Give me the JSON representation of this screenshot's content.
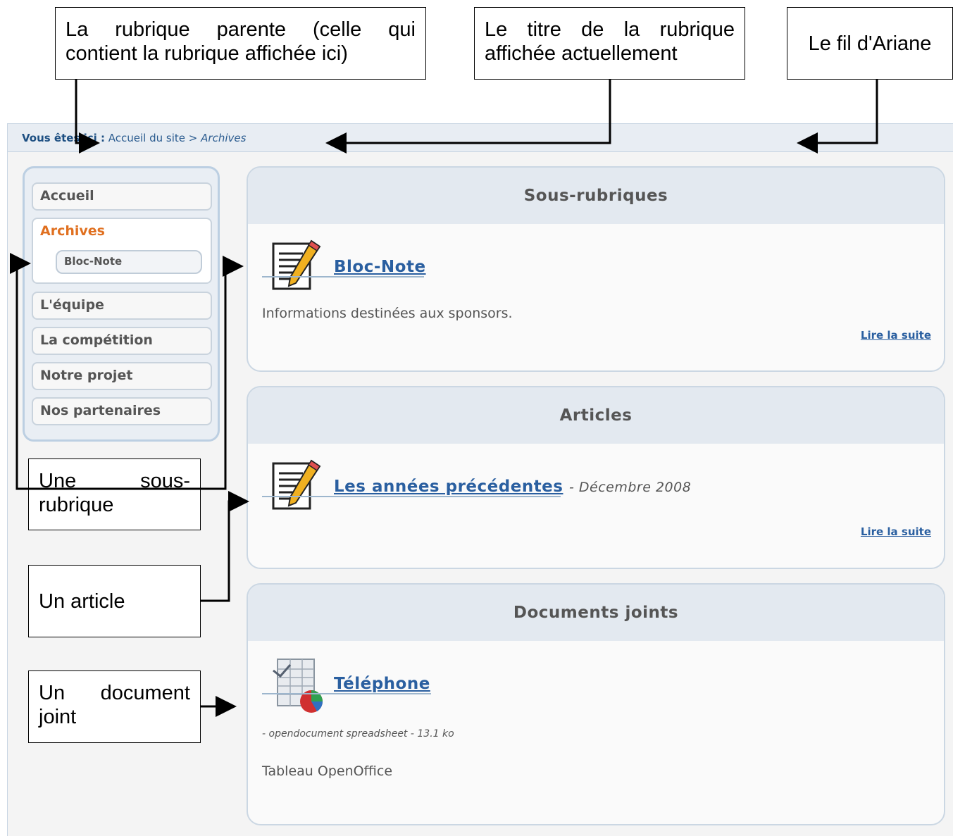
{
  "callouts": {
    "parent": [
      "La rubrique parente (celle qui",
      "contient la rubrique affichée ici)"
    ],
    "title": [
      "Le titre de la rubrique",
      "affichée actuellement"
    ],
    "breadcrumb": "Le fil d'Ariane",
    "subsection": [
      "Une sous-",
      "rubrique"
    ],
    "article": "Un article",
    "document": [
      "Un document",
      "joint"
    ]
  },
  "breadcrumb": {
    "label": "Vous êtes ici :",
    "home": "Accueil du site",
    "separator": ">",
    "current": "Archives"
  },
  "sidebar": {
    "items": [
      {
        "label": "Accueil"
      },
      {
        "label": "Archives",
        "active": true,
        "sub": "Bloc-Note"
      },
      {
        "label": "L'équipe"
      },
      {
        "label": "La compétition"
      },
      {
        "label": "Notre projet"
      },
      {
        "label": "Nos partenaires"
      }
    ]
  },
  "sections": {
    "subsections": {
      "heading": "Sous-rubriques",
      "item_title": "Bloc-Note",
      "item_desc": "Informations destinées aux sponsors.",
      "read_more": "Lire la suite",
      "icon": "notepad-pencil-icon"
    },
    "articles": {
      "heading": "Articles",
      "item_title": "Les années précédentes",
      "item_date": "- Décembre 2008",
      "read_more": "Lire la suite",
      "icon": "notepad-pencil-icon"
    },
    "documents": {
      "heading": "Documents joints",
      "item_title": "Téléphone",
      "item_meta": "- opendocument spreadsheet - 13.1 ko",
      "item_desc": "Tableau OpenOffice",
      "icon": "spreadsheet-chart-icon"
    }
  },
  "colors": {
    "link": "#2a5fa0",
    "active": "#e07020",
    "panel_head": "#e3e9f0"
  }
}
